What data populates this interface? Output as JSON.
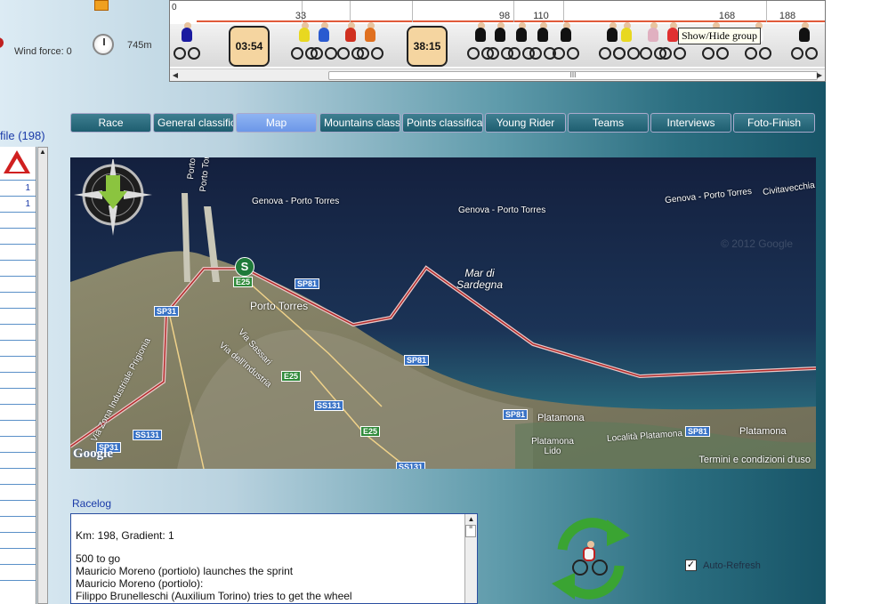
{
  "weather": {
    "wind_label": "Wind force: 0",
    "altitude": "745m"
  },
  "strip": {
    "km_zero": "0",
    "km_marks": [
      "33",
      "98",
      "110",
      "168",
      "188"
    ],
    "timers": [
      "03:54",
      "38:15"
    ],
    "group_tooltip": "Show/Hide group",
    "scroll_thumb": "III"
  },
  "profile": {
    "title": "file (198)",
    "rows": [
      "1",
      "1",
      "",
      "",
      "",
      "",
      "",
      "",
      "",
      "",
      "",
      "",
      "",
      "",
      "",
      "",
      "",
      "",
      "",
      "",
      "",
      "",
      "",
      "",
      ""
    ]
  },
  "tabs": [
    {
      "label": "Race",
      "active": false
    },
    {
      "label": "General classification",
      "active": false
    },
    {
      "label": "Map",
      "active": true
    },
    {
      "label": "Mountains classification",
      "active": false
    },
    {
      "label": "Points classification",
      "active": false
    },
    {
      "label": "Young Rider",
      "active": false
    },
    {
      "label": "Teams",
      "active": false
    },
    {
      "label": "Interviews",
      "active": false
    },
    {
      "label": "Foto-Finish",
      "active": false
    }
  ],
  "map": {
    "roads": [
      {
        "text": "Genova - Porto Torres"
      },
      {
        "text": "Genova - Porto Torres"
      },
      {
        "text": "Genova - Porto Torres"
      },
      {
        "text": "Civitavecchia"
      },
      {
        "text": "Porto Torres - Ajaccio"
      },
      {
        "text": "Porto Torres"
      },
      {
        "text": "Via Sassari"
      },
      {
        "text": "Via dell'Industria"
      },
      {
        "text": "Via Zona Industriale Prigionia"
      },
      {
        "text": "Località Platamona"
      }
    ],
    "towns": [
      "Porto Torres",
      "Platamona",
      "Platamona Lido",
      "Platamona"
    ],
    "sea_name": "Mar di Sardegna",
    "badges": [
      "E25",
      "SP81",
      "SP81",
      "SP81",
      "SP81",
      "SS131",
      "SS131",
      "SP31",
      "SS131",
      "E25",
      "E25",
      "SP31"
    ],
    "start_marker": "S",
    "compass_n": "N",
    "compass_w": "W",
    "google_logo": "Google",
    "watermark": "© 2012 Google",
    "terms": "Termini e condizioni d'uso"
  },
  "racelog": {
    "title": "Racelog",
    "lines": [
      "Km: 198, Gradient: 1",
      "",
      "500 to go",
      "Mauricio Moreno (portiolo) launches the sprint",
      "Mauricio Moreno (portiolo):",
      "Filippo Brunelleschi (Auxilium Torino) tries to get the wheel"
    ]
  },
  "controls": {
    "auto_refresh_label": "Auto-Refresh",
    "auto_refresh_checked": true
  }
}
